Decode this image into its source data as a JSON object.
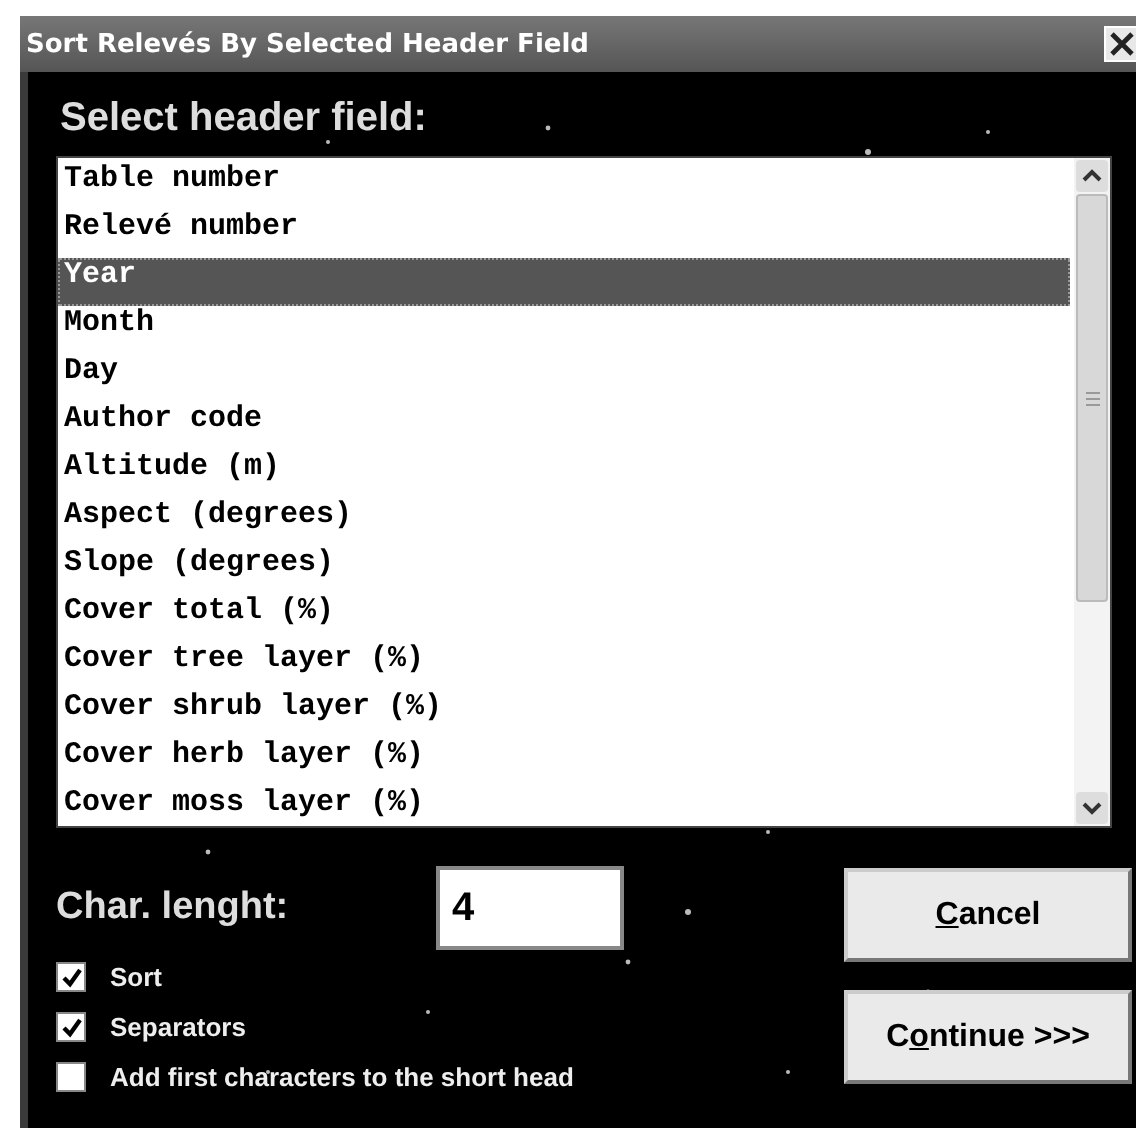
{
  "window": {
    "title": "Sort Relevés By Selected Header Field"
  },
  "heading": "Select header field:",
  "list": [
    {
      "label": "Table number",
      "selected": false
    },
    {
      "label": "Relevé number",
      "selected": false
    },
    {
      "label": "Year",
      "selected": true
    },
    {
      "label": "Month",
      "selected": false
    },
    {
      "label": "Day",
      "selected": false
    },
    {
      "label": "Author code",
      "selected": false
    },
    {
      "label": "Altitude (m)",
      "selected": false
    },
    {
      "label": "Aspect (degrees)",
      "selected": false
    },
    {
      "label": "Slope (degrees)",
      "selected": false
    },
    {
      "label": "Cover total (%)",
      "selected": false
    },
    {
      "label": "Cover tree layer (%)",
      "selected": false
    },
    {
      "label": "Cover shrub layer (%)",
      "selected": false
    },
    {
      "label": "Cover herb layer (%)",
      "selected": false
    },
    {
      "label": "Cover moss layer (%)",
      "selected": false
    }
  ],
  "char_length": {
    "label": "Char. lenght:",
    "value": "4"
  },
  "checkboxes": [
    {
      "label": "Sort",
      "checked": true
    },
    {
      "label": "Separators",
      "checked": true
    },
    {
      "label": "Add first characters to the short head",
      "checked": false
    }
  ],
  "buttons": [
    {
      "mnemonic": "C",
      "label_after": "ancel"
    },
    {
      "label_before": "C",
      "mnemonic": "o",
      "label_after": "ntinue >>>"
    }
  ]
}
